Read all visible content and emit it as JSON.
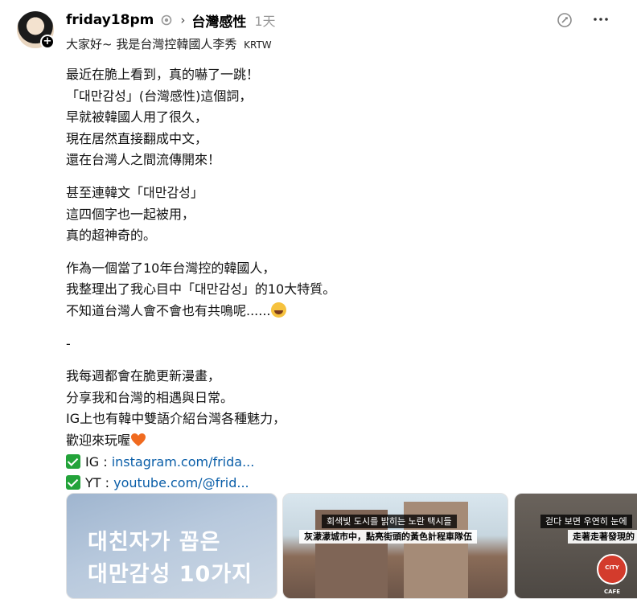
{
  "post": {
    "username": "friday18pm",
    "topic": "台灣感性",
    "time": "1天",
    "bio": "大家好~ 我是台灣控韓國人李秀",
    "bio_tag": "KRTW",
    "paragraphs": [
      [
        "最近在脆上看到，真的嚇了一跳！",
        "「대만감성」(台灣感性)這個詞，",
        "早就被韓國人用了很久，",
        "現在居然直接翻成中文，",
        "還在台灣人之間流傳開來！"
      ],
      [
        "甚至連韓文「대만감성」",
        "這四個字也一起被用，",
        "真的超神奇的。"
      ],
      [
        "作為一個當了10年台灣控的韓國人，",
        "我整理出了我心目中「대만감성」的10大特質。",
        "不知道台灣人會不會也有共鳴呢......"
      ],
      [
        "-"
      ],
      [
        "我每週都會在脆更新漫畫，",
        "分享我和台灣的相遇與日常。",
        "IG上也有韓中雙語介紹台灣各種魅力，",
        "歡迎來玩喔"
      ]
    ],
    "links": [
      {
        "label": "IG : ",
        "url": "instagram.com/frida..."
      },
      {
        "label": "YT : ",
        "url": "youtube.com/@frid..."
      }
    ]
  },
  "media": {
    "card1_lines": [
      "대친자가 꼽은",
      "대만감성 10가지"
    ],
    "card2_sub_ko": "회색빛 도시를 밝히는 노란 택시들",
    "card2_sub_zh": "灰濛濛城市中，點亮街頭的黃色計程車隊伍",
    "card3_sub_ko": "걷다 보면 우연히 눈에",
    "card3_sub_zh": "走著走著發現的",
    "card3_logo": "CITY CAFE"
  },
  "icons": {
    "avatar_plus": "+",
    "chevron": "›"
  },
  "colors": {
    "link": "#0a5ea8",
    "check": "#23a33a",
    "heart": "#f06a1f",
    "muted": "#999999"
  }
}
